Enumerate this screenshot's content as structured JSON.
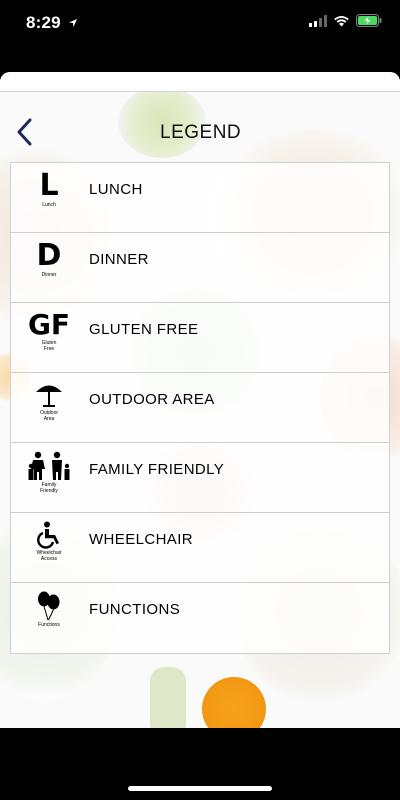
{
  "status_bar": {
    "time": "8:29",
    "location_icon": "location-arrow-icon",
    "signal_icon": "cellular-signal-icon",
    "wifi_icon": "wifi-icon",
    "battery_icon": "battery-charging-icon",
    "battery_color": "#4cd964"
  },
  "header": {
    "title": "LEGEND",
    "back_icon": "chevron-left-icon",
    "back_color": "#1f2a5a"
  },
  "legend": {
    "items": [
      {
        "label": "LUNCH",
        "icon": "lunch-icon",
        "symbol": "L",
        "caption": "Lunch"
      },
      {
        "label": "DINNER",
        "icon": "dinner-icon",
        "symbol": "D",
        "caption": "Dinner"
      },
      {
        "label": "GLUTEN FREE",
        "icon": "gluten-free-icon",
        "symbol": "GF",
        "caption": "Gluten\nFree"
      },
      {
        "label": "OUTDOOR AREA",
        "icon": "umbrella-icon",
        "symbol": "",
        "caption": "Outdoor\nArea"
      },
      {
        "label": "FAMILY FRIENDLY",
        "icon": "family-icon",
        "symbol": "",
        "caption": "Family\nFriendly"
      },
      {
        "label": "WHEELCHAIR",
        "icon": "wheelchair-icon",
        "symbol": "",
        "caption": "Wheelchair\nAccess"
      },
      {
        "label": "FUNCTIONS",
        "icon": "balloons-icon",
        "symbol": "",
        "caption": "Functions"
      }
    ]
  }
}
